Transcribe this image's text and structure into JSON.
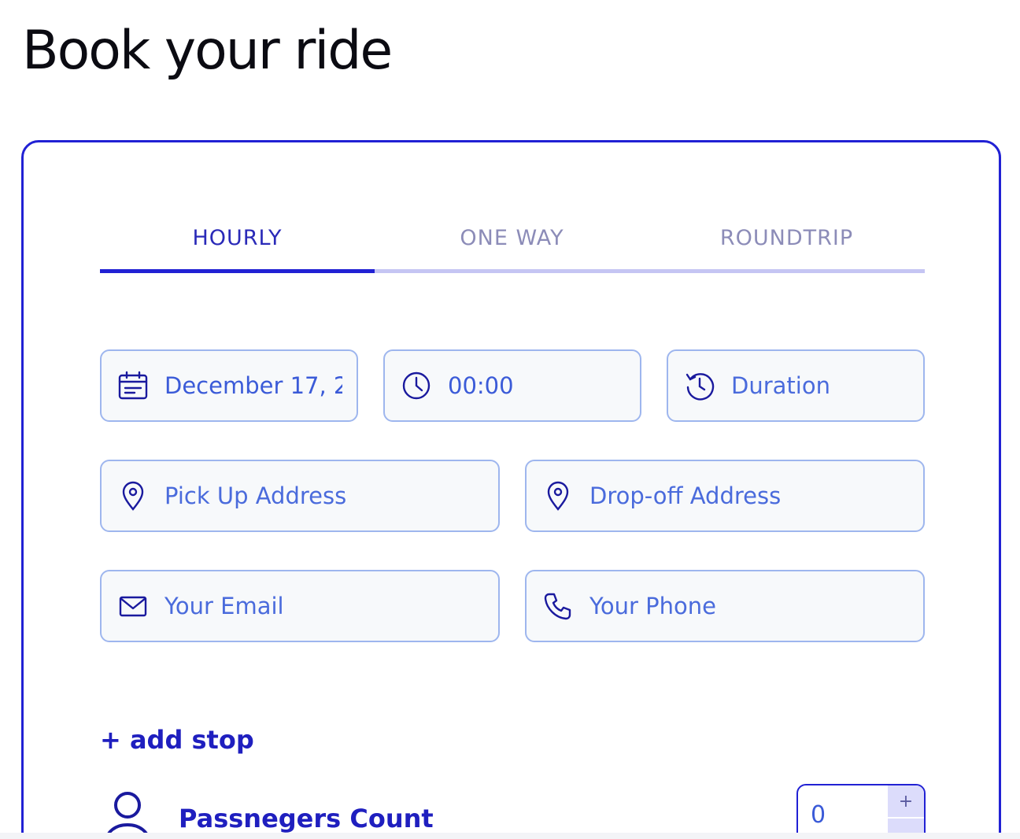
{
  "page": {
    "title": "Book your ride"
  },
  "tabs": [
    {
      "label": "HOURLY",
      "active": true
    },
    {
      "label": "ONE WAY",
      "active": false
    },
    {
      "label": "ROUNDTRIP",
      "active": false
    }
  ],
  "form": {
    "date": {
      "value": "December 17, 2",
      "icon": "calendar-icon"
    },
    "time": {
      "value": "00:00",
      "icon": "clock-icon"
    },
    "duration": {
      "placeholder": "Duration",
      "icon": "history-icon"
    },
    "pickup": {
      "placeholder": "Pick Up Address",
      "icon": "map-pin-icon"
    },
    "dropoff": {
      "placeholder": "Drop-off Address",
      "icon": "map-pin-icon"
    },
    "email": {
      "placeholder": "Your Email",
      "icon": "mail-icon"
    },
    "phone": {
      "placeholder": "Your Phone",
      "icon": "phone-icon"
    }
  },
  "add_stop": {
    "label": "+ add stop"
  },
  "passengers": {
    "label": "Passnegers Count",
    "value": "0",
    "increment_label": "+",
    "decrement_label": "-"
  },
  "colors": {
    "accent": "#2121d4",
    "field_border": "#9eb6ee",
    "field_bg": "#f7f9fb",
    "text_blue": "#3b5bd8",
    "tab_inactive": "#8c8cb8"
  }
}
